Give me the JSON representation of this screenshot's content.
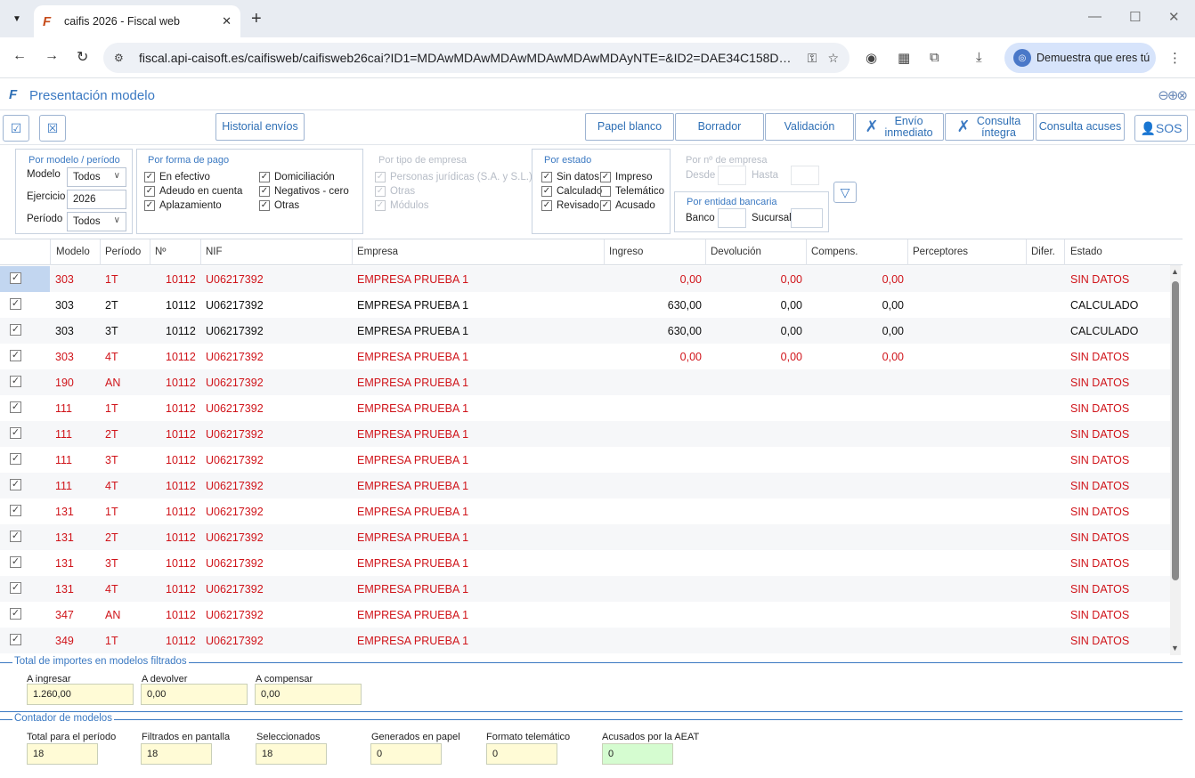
{
  "browser": {
    "tab_title": "caifis 2026 - Fiscal web",
    "url": "fiscal.api-caisoft.es/caifisweb/caifisweb26cai?ID1=MDAwMDAwMDAwMDAwMDAwMDAyNTE=&ID2=DAE34C158D…",
    "profile_button": "Demuestra que eres tú"
  },
  "app": {
    "title": "Presentación modelo"
  },
  "toolbar": {
    "historial": "Historial envíos",
    "papel_blanco": "Papel blanco",
    "borrador": "Borrador",
    "validacion": "Validación",
    "envio_inmediato": "Envío inmediato",
    "consulta_integra": "Consulta íntegra",
    "consulta_acuses": "Consulta acuses"
  },
  "filters": {
    "modelo_periodo": {
      "legend": "Por modelo / período",
      "modelo_label": "Modelo",
      "modelo_value": "Todos",
      "ejercicio_label": "Ejercicio",
      "ejercicio_value": "2026",
      "periodo_label": "Período",
      "periodo_value": "Todos"
    },
    "forma_pago": {
      "legend": "Por forma de pago",
      "opt1": "En efectivo",
      "opt2": "Adeudo en cuenta",
      "opt3": "Aplazamiento",
      "opt4": "Domiciliación",
      "opt5": "Negativos - cero",
      "opt6": "Otras"
    },
    "tipo_empresa": {
      "legend": "Por tipo de empresa",
      "opt1": "Personas jurídicas (S.A. y S.L.)",
      "opt2": "Otras",
      "opt3": "Módulos"
    },
    "estado": {
      "legend": "Por estado",
      "opt1": "Sin datos",
      "opt2": "Calculado",
      "opt3": "Revisado",
      "opt4": "Impreso",
      "opt5": "Telemático",
      "opt6": "Acusado"
    },
    "num_empresa": {
      "legend": "Por nº de empresa",
      "desde": "Desde",
      "hasta": "Hasta"
    },
    "entidad": {
      "legend": "Por entidad bancaria",
      "banco": "Banco",
      "sucursal": "Sucursal"
    }
  },
  "grid": {
    "headers": {
      "modelo": "Modelo",
      "periodo": "Período",
      "numero": "Nº",
      "nif": "NIF",
      "empresa": "Empresa",
      "ingreso": "Ingreso",
      "devolucion": "Devolución",
      "compens": "Compens.",
      "perceptores": "Perceptores",
      "difer": "Difer.",
      "estado": "Estado"
    },
    "rows": [
      {
        "modelo": "303",
        "periodo": "1T",
        "numero": "10112",
        "nif": "U06217392",
        "empresa": "EMPRESA PRUEBA 1",
        "ingreso": "0,00",
        "devolucion": "0,00",
        "compens": "0,00",
        "estado": "SIN DATOS",
        "color": "red"
      },
      {
        "modelo": "303",
        "periodo": "2T",
        "numero": "10112",
        "nif": "U06217392",
        "empresa": "EMPRESA PRUEBA 1",
        "ingreso": "630,00",
        "devolucion": "0,00",
        "compens": "0,00",
        "estado": "CALCULADO",
        "color": "blk"
      },
      {
        "modelo": "303",
        "periodo": "3T",
        "numero": "10112",
        "nif": "U06217392",
        "empresa": "EMPRESA PRUEBA 1",
        "ingreso": "630,00",
        "devolucion": "0,00",
        "compens": "0,00",
        "estado": "CALCULADO",
        "color": "blk"
      },
      {
        "modelo": "303",
        "periodo": "4T",
        "numero": "10112",
        "nif": "U06217392",
        "empresa": "EMPRESA PRUEBA 1",
        "ingreso": "0,00",
        "devolucion": "0,00",
        "compens": "0,00",
        "estado": "SIN DATOS",
        "color": "red"
      },
      {
        "modelo": "190",
        "periodo": "AN",
        "numero": "10112",
        "nif": "U06217392",
        "empresa": "EMPRESA PRUEBA 1",
        "ingreso": "",
        "devolucion": "",
        "compens": "",
        "estado": "SIN DATOS",
        "color": "red"
      },
      {
        "modelo": "111",
        "periodo": "1T",
        "numero": "10112",
        "nif": "U06217392",
        "empresa": "EMPRESA PRUEBA 1",
        "ingreso": "",
        "devolucion": "",
        "compens": "",
        "estado": "SIN DATOS",
        "color": "red"
      },
      {
        "modelo": "111",
        "periodo": "2T",
        "numero": "10112",
        "nif": "U06217392",
        "empresa": "EMPRESA PRUEBA 1",
        "ingreso": "",
        "devolucion": "",
        "compens": "",
        "estado": "SIN DATOS",
        "color": "red"
      },
      {
        "modelo": "111",
        "periodo": "3T",
        "numero": "10112",
        "nif": "U06217392",
        "empresa": "EMPRESA PRUEBA 1",
        "ingreso": "",
        "devolucion": "",
        "compens": "",
        "estado": "SIN DATOS",
        "color": "red"
      },
      {
        "modelo": "111",
        "periodo": "4T",
        "numero": "10112",
        "nif": "U06217392",
        "empresa": "EMPRESA PRUEBA 1",
        "ingreso": "",
        "devolucion": "",
        "compens": "",
        "estado": "SIN DATOS",
        "color": "red"
      },
      {
        "modelo": "131",
        "periodo": "1T",
        "numero": "10112",
        "nif": "U06217392",
        "empresa": "EMPRESA PRUEBA 1",
        "ingreso": "",
        "devolucion": "",
        "compens": "",
        "estado": "SIN DATOS",
        "color": "red"
      },
      {
        "modelo": "131",
        "periodo": "2T",
        "numero": "10112",
        "nif": "U06217392",
        "empresa": "EMPRESA PRUEBA 1",
        "ingreso": "",
        "devolucion": "",
        "compens": "",
        "estado": "SIN DATOS",
        "color": "red"
      },
      {
        "modelo": "131",
        "periodo": "3T",
        "numero": "10112",
        "nif": "U06217392",
        "empresa": "EMPRESA PRUEBA 1",
        "ingreso": "",
        "devolucion": "",
        "compens": "",
        "estado": "SIN DATOS",
        "color": "red"
      },
      {
        "modelo": "131",
        "periodo": "4T",
        "numero": "10112",
        "nif": "U06217392",
        "empresa": "EMPRESA PRUEBA 1",
        "ingreso": "",
        "devolucion": "",
        "compens": "",
        "estado": "SIN DATOS",
        "color": "red"
      },
      {
        "modelo": "347",
        "periodo": "AN",
        "numero": "10112",
        "nif": "U06217392",
        "empresa": "EMPRESA PRUEBA 1",
        "ingreso": "",
        "devolucion": "",
        "compens": "",
        "estado": "SIN DATOS",
        "color": "red"
      },
      {
        "modelo": "349",
        "periodo": "1T",
        "numero": "10112",
        "nif": "U06217392",
        "empresa": "EMPRESA PRUEBA 1",
        "ingreso": "",
        "devolucion": "",
        "compens": "",
        "estado": "SIN DATOS",
        "color": "red"
      }
    ]
  },
  "totales": {
    "legend": "Total de importes en modelos filtrados",
    "ingresar_label": "A ingresar",
    "ingresar_value": "1.260,00",
    "devolver_label": "A devolver",
    "devolver_value": "0,00",
    "compensar_label": "A compensar",
    "compensar_value": "0,00"
  },
  "contador": {
    "legend": "Contador de modelos",
    "total_label": "Total para el período",
    "total_value": "18",
    "filtrados_label": "Filtrados en pantalla",
    "filtrados_value": "18",
    "seleccionados_label": "Seleccionados",
    "seleccionados_value": "18",
    "papel_label": "Generados en papel",
    "papel_value": "0",
    "telematico_label": "Formato telemático",
    "telematico_value": "0",
    "acusados_label": "Acusados por la AEAT",
    "acusados_value": "0"
  },
  "colors": {
    "accent": "#3b79c2",
    "error_red": "#d0141a",
    "total_bg": "#fffbd6",
    "acusados_bg": "#d5fcd0"
  }
}
